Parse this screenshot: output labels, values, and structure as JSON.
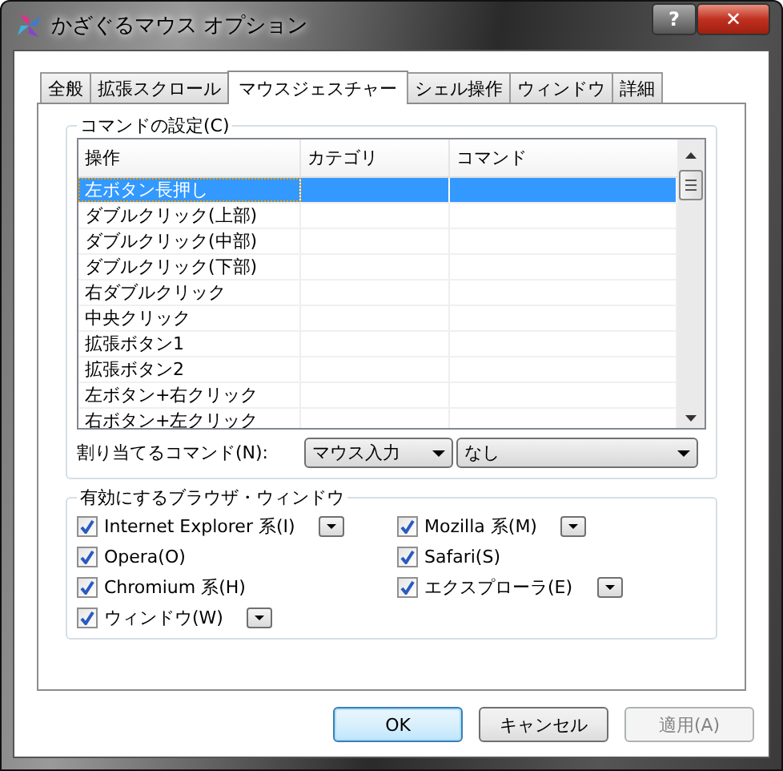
{
  "window": {
    "title": "かざぐるマウス オプション",
    "help_button": "?",
    "close_button": "✕"
  },
  "tabs": [
    {
      "label": "全般",
      "selected": false
    },
    {
      "label": "拡張スクロール",
      "selected": false
    },
    {
      "label": "マウスジェスチャー",
      "selected": true
    },
    {
      "label": "シェル操作",
      "selected": false
    },
    {
      "label": "ウィンドウ",
      "selected": false
    },
    {
      "label": "詳細",
      "selected": false
    }
  ],
  "command_group": {
    "title": "コマンドの設定(C)",
    "columns": [
      "操作",
      "カテゴリ",
      "コマンド"
    ],
    "rows": [
      {
        "action": "左ボタン長押し",
        "selected": true
      },
      {
        "action": "ダブルクリック(上部)",
        "selected": false
      },
      {
        "action": "ダブルクリック(中部)",
        "selected": false
      },
      {
        "action": "ダブルクリック(下部)",
        "selected": false
      },
      {
        "action": "右ダブルクリック",
        "selected": false
      },
      {
        "action": "中央クリック",
        "selected": false
      },
      {
        "action": "拡張ボタン1",
        "selected": false
      },
      {
        "action": "拡張ボタン2",
        "selected": false
      },
      {
        "action": "左ボタン+右クリック",
        "selected": false
      },
      {
        "action": "右ボタン+左クリック",
        "selected": false
      }
    ],
    "assign_label": "割り当てるコマンド(N):",
    "category_value": "マウス入力",
    "command_value": "なし"
  },
  "browser_group": {
    "title": "有効にするブラウザ・ウィンドウ",
    "items": [
      {
        "label": "Internet Explorer 系(I)",
        "checked": true,
        "has_menu": true
      },
      {
        "label": "Mozilla 系(M)",
        "checked": true,
        "has_menu": true
      },
      {
        "label": "Opera(O)",
        "checked": true,
        "has_menu": false
      },
      {
        "label": "Safari(S)",
        "checked": true,
        "has_menu": false
      },
      {
        "label": "Chromium 系(H)",
        "checked": true,
        "has_menu": false
      },
      {
        "label": "エクスプローラ(E)",
        "checked": true,
        "has_menu": true
      },
      {
        "label": "ウィンドウ(W)",
        "checked": true,
        "has_menu": true
      }
    ]
  },
  "buttons": [
    {
      "label": "OK",
      "kind": "default"
    },
    {
      "label": "キャンセル",
      "kind": "normal"
    },
    {
      "label": "適用(A)",
      "kind": "disabled"
    }
  ]
}
